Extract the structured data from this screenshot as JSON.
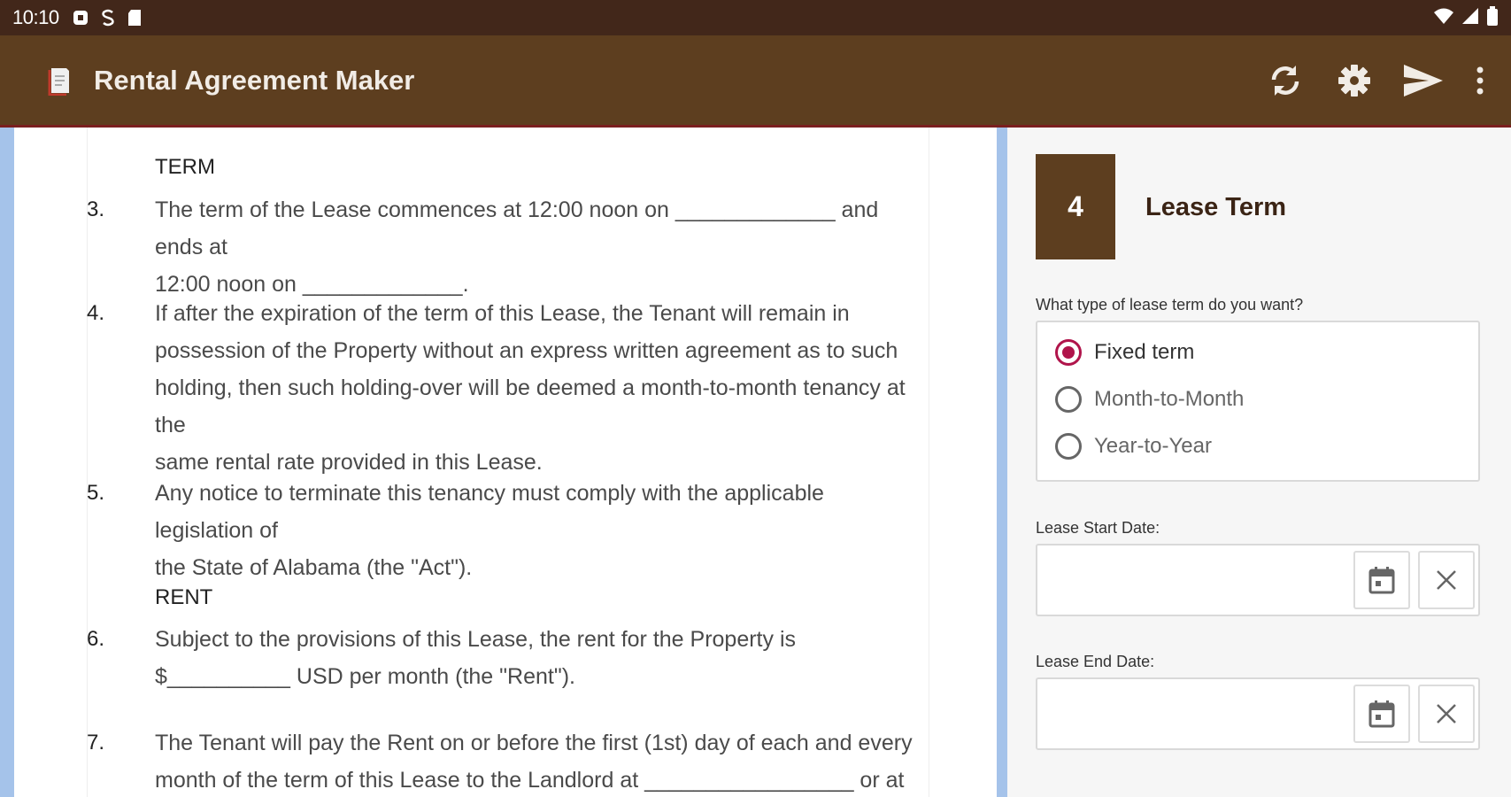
{
  "status_bar": {
    "time": "10:10",
    "left_icons": [
      "notification-box-icon",
      "s-app-icon",
      "sd-card-icon"
    ],
    "right_icons": [
      "wifi-icon",
      "signal-icon",
      "battery-icon"
    ]
  },
  "app_bar": {
    "title": "Rental Agreement Maker",
    "actions": [
      "refresh-icon",
      "settings-gear-icon",
      "send-icon",
      "more-vertical-icon"
    ]
  },
  "document": {
    "heading_term": "TERM",
    "heading_rent": "RENT",
    "clauses": [
      {
        "num": "3.",
        "lines": [
          "The term of the Lease commences at 12:00 noon on _____________ and ends at",
          "12:00 noon on _____________."
        ]
      },
      {
        "num": "4.",
        "lines": [
          "If after the expiration of the term of this Lease, the Tenant will remain in",
          "possession of the Property without an express written agreement as to such",
          "holding, then such holding-over will be deemed a month-to-month tenancy at the",
          "same rental rate provided in this Lease."
        ]
      },
      {
        "num": "5.",
        "lines": [
          "Any notice to terminate this tenancy must comply with the applicable legislation of",
          "the State of Alabama (the \"Act\")."
        ]
      },
      {
        "num": "6.",
        "lines": [
          "Subject to the provisions of this Lease, the rent for the Property is",
          "$__________ USD per month (the \"Rent\")."
        ]
      },
      {
        "num": "7.",
        "lines": [
          "The Tenant will pay the Rent on or before the first (1st) day of each and every",
          "month of the term of this Lease to the Landlord at _________________ or at"
        ]
      }
    ]
  },
  "form": {
    "step_number": "4",
    "step_title": "Lease Term",
    "question": "What type of lease term do you want?",
    "options": [
      {
        "label": "Fixed term",
        "selected": true
      },
      {
        "label": "Month-to-Month",
        "selected": false
      },
      {
        "label": "Year-to-Year",
        "selected": false
      }
    ],
    "start_date_label": "Lease Start Date:",
    "start_date_value": "",
    "end_date_label": "Lease End Date:",
    "end_date_value": "",
    "accent_color": "#b0144b",
    "brand_color": "#5d3e1f"
  }
}
